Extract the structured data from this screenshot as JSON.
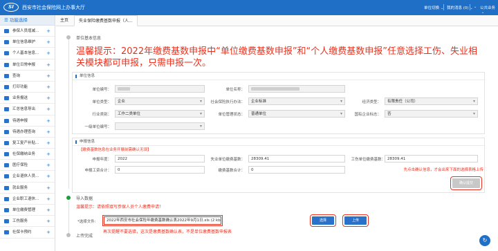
{
  "header": {
    "logo_text": "SI",
    "title": "西安市社会保险网上办事大厅",
    "right_items": [
      {
        "label": "单位切换",
        "icon": "chevron-down-icon"
      },
      {
        "label": "我的消息 (0)",
        "icon": "chevron-down-icon"
      },
      {
        "label": "",
        "icon": "chevron-down-icon"
      },
      {
        "label": "公共业务",
        "icon": "chevron-down-icon"
      }
    ],
    "colors": {
      "bar": "#1f6fc7"
    }
  },
  "sidebar": {
    "header": "☰ 功能选择",
    "items": [
      {
        "label": "参保人员增减...",
        "icon": "user-icon"
      },
      {
        "label": "单位信息维护",
        "icon": "building-icon"
      },
      {
        "label": "个人基本信息...",
        "icon": "person-icon"
      },
      {
        "label": "单位日常申报",
        "icon": "calendar-icon"
      },
      {
        "label": "查询",
        "icon": "search-icon"
      },
      {
        "label": "打印功能",
        "icon": "printer-icon"
      },
      {
        "label": "业务报送",
        "icon": "send-icon"
      },
      {
        "label": "汇总信息导出",
        "icon": "export-icon"
      },
      {
        "label": "待遇申报",
        "icon": "document-icon"
      },
      {
        "label": "待遇办理查询",
        "icon": "search-icon"
      },
      {
        "label": "复工复产补贴...",
        "icon": "money-icon"
      },
      {
        "label": "社保缴纳业务",
        "icon": "card-icon"
      },
      {
        "label": "医疗保险",
        "icon": "medical-icon"
      },
      {
        "label": "企业退休人员...",
        "icon": "user-icon"
      },
      {
        "label": "就业服务",
        "icon": "briefcase-icon"
      },
      {
        "label": "企业职工退休...",
        "icon": "user-icon"
      },
      {
        "label": "单位缴费管理",
        "icon": "wallet-icon"
      },
      {
        "label": "工伤服务",
        "icon": "shield-icon"
      },
      {
        "label": "社保卡预约",
        "icon": "card-icon"
      }
    ]
  },
  "tabs": [
    {
      "label": "主页"
    },
    {
      "label": "失业保险缴费基数申报（人..."
    }
  ],
  "main": {
    "step1_label": "单位基本信息",
    "warm_tip": "温馨提示：2022年缴费基数申报中“单位缴费基数申报”和“个人缴费基数申报”任意选择工伤、失业相关模块都可申报，只需申报一次。",
    "unit_section": {
      "title": "单位信息",
      "fields": {
        "unit_no_label": "单位编号：",
        "unit_name_label": "单位名称：",
        "unit_type_label": "单位类型：",
        "unit_type_value": "企业",
        "si_exec_label": "社会保险执行办法：",
        "si_exec_value": "企业标准",
        "econ_type_label": "经济类型：",
        "econ_type_value": "有限责任（公司）",
        "industry_label": "行业类别：",
        "industry_value": "工作二类单位",
        "mgmt_status_label": "单位管理状态：",
        "mgmt_status_value": "普通单位",
        "state_owned_label": "国有企业标志：",
        "state_owned_value": "否",
        "level1_label": "一级单位编号："
      }
    },
    "declare_section": {
      "title": "申报信息",
      "notice": "【缴费基数信息在业务开展前需确认无误】",
      "fields": {
        "year_label": "申报年度：",
        "year_value": "2022",
        "unemp_base_label": "失业单位缴费基数：",
        "unemp_base_value": "28309.41",
        "injury_base_label": "工伤单位缴费基数：",
        "injury_base_value": "28309.41",
        "wage_total_label": "申报工资合计：",
        "wage_total_value": "0",
        "base_total_label": "缴费基数合计：",
        "base_total_value": "0"
      },
      "red_hint": "先点击确认信息，才会出来下面的选择表格上传",
      "confirm_label": "确认提交"
    },
    "step2": {
      "label": "导入数据",
      "tip": "温馨提示：请依照填写参保人员个人缴费申请！",
      "file_label": "*选择文件:",
      "file_value": "2022年西安市社会保险年缴费基数确认表2022年9月1日.xls (2 kb)",
      "browse_label": "选择",
      "upload_label": "上传",
      "red_note": "再次提醒不要选错，这次是缴费基数确认表，不是单位缴费基数申报表"
    },
    "step3_label": "上传完成",
    "colors": {
      "warn": "#e8321f",
      "primary": "#1f6fc7",
      "done": "#1aa039"
    }
  },
  "help_icon": "?"
}
